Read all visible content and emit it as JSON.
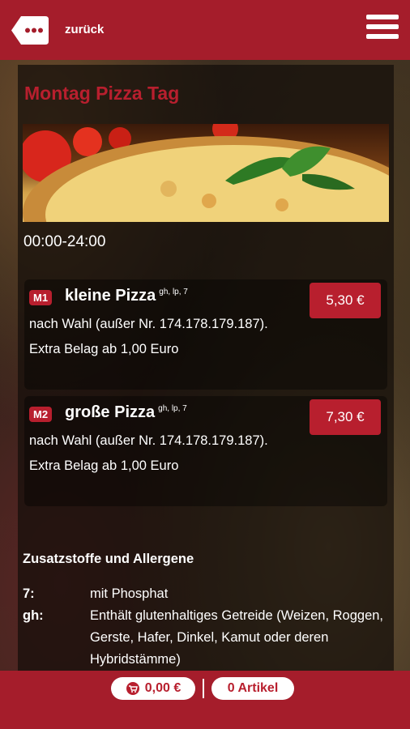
{
  "header": {
    "back_label": "zurück",
    "back_icon": "dots-icon",
    "menu_icon": "hamburger-icon",
    "accent": "#a51d2b"
  },
  "main": {
    "title": "Montag Pizza Tag",
    "hours": "00:00-24:00",
    "items": [
      {
        "badge": "M1",
        "name": "kleine Pizza",
        "allergens": "gh, lp, 7",
        "desc": "nach Wahl (außer Nr. 174.178.179.187). Extra Belag ab 1,00 Euro",
        "price": "5,30 €"
      },
      {
        "badge": "M2",
        "name": "große Pizza",
        "allergens": "gh, lp, 7",
        "desc": "nach Wahl (außer Nr. 174.178.179.187). Extra Belag ab 1,00 Euro",
        "price": "7,30 €"
      }
    ],
    "allergen_title": "Zusatzstoffe und Allergene",
    "allergens": [
      {
        "code": "7:",
        "text": "mit Phosphat"
      },
      {
        "code": "gh:",
        "text": "Enthält glutenhaltiges Getreide (Weizen, Roggen, Gerste, Hafer, Dinkel, Kamut oder deren Hybridstämme)"
      }
    ]
  },
  "footer": {
    "cart_total": "0,00 €",
    "cart_icon": "cart-icon",
    "item_count": "0 Artikel"
  }
}
